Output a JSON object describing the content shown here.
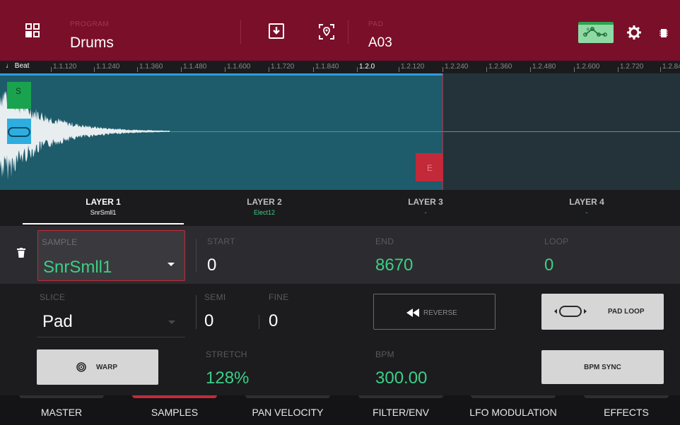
{
  "header": {
    "program_label": "PROGRAM",
    "program_value": "Drums",
    "pad_label": "PAD",
    "pad_value": "A03",
    "icons": [
      "grid-icon",
      "download-icon",
      "pad-locate-icon",
      "envelope-icon",
      "gear-icon",
      "battery-icon"
    ]
  },
  "ruler": {
    "beat_label": "♩ Beat",
    "ticks": [
      "1.1.120",
      "1.1.240",
      "1.1.360",
      "1.1.480",
      "1.1.600",
      "1.1.720",
      "1.1.840",
      "1.2.0",
      "1.2.120",
      "1.2.240",
      "1.2.360",
      "1.2.480",
      "1.2.600",
      "1.2.720",
      "1.2.84"
    ]
  },
  "waveform": {
    "start_marker": "S",
    "end_marker": "E"
  },
  "layers": [
    {
      "title": "LAYER 1",
      "sample": "SnrSmll1",
      "active": true
    },
    {
      "title": "LAYER 2",
      "sample": "Elect12",
      "active": false
    },
    {
      "title": "LAYER 3",
      "sample": "-",
      "active": false
    },
    {
      "title": "LAYER 4",
      "sample": "-",
      "active": false
    }
  ],
  "params": {
    "sample_label": "SAMPLE",
    "sample_value": "SnrSmll1",
    "start_label": "START",
    "start_value": "0",
    "end_label": "END",
    "end_value": "8670",
    "loop_label": "LOOP",
    "loop_value": "0",
    "slice_label": "SLICE",
    "slice_value": "Pad",
    "semi_label": "SEMI",
    "semi_value": "0",
    "fine_label": "FINE",
    "fine_value": "0",
    "reverse_label": "REVERSE",
    "pad_loop_label": "PAD LOOP",
    "warp_label": "WARP",
    "stretch_label": "STRETCH",
    "stretch_value": "128%",
    "bpm_label": "BPM",
    "bpm_value": "300.00",
    "bpm_sync_label": "BPM SYNC"
  },
  "bottom_tabs": [
    {
      "label": "MASTER",
      "active": false
    },
    {
      "label": "SAMPLES",
      "active": true
    },
    {
      "label": "PAN VELOCITY",
      "active": false
    },
    {
      "label": "FILTER/ENV",
      "active": false
    },
    {
      "label": "LFO MODULATION",
      "active": false
    },
    {
      "label": "EFFECTS",
      "active": false
    }
  ],
  "colors": {
    "header_bg": "#7a0f29",
    "accent_green": "#3ccf86",
    "accent_red": "#c22a39",
    "waveform_bg": "#1e5c6b"
  }
}
